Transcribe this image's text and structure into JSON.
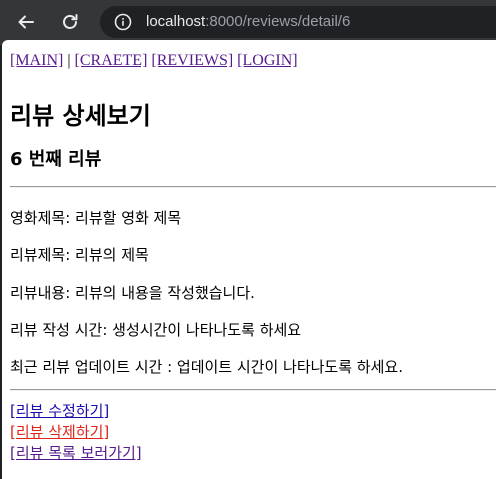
{
  "browser": {
    "url_host": "localhost",
    "url_rest": ":8000/reviews/detail/6"
  },
  "nav": {
    "main": "[MAIN]",
    "separator": "|",
    "create": "[CRAETE]",
    "reviews": "[REVIEWS]",
    "login": "[LOGIN]"
  },
  "page": {
    "title": "리뷰 상세보기",
    "subtitle": "6 번째 리뷰"
  },
  "details": {
    "movie_title": "영화제목: 리뷰할 영화 제목",
    "review_title": "리뷰제목: 리뷰의 제목",
    "review_content": "리뷰내용: 리뷰의 내용을 작성했습니다.",
    "created_time": "리뷰 작성 시간: 생성시간이 나타나도록 하세요",
    "updated_time": "최근 리뷰 업데이트 시간 : 업데이트 시간이 나타나도록 하세요."
  },
  "actions": {
    "edit": "[리뷰 수정하기]",
    "delete": "[리뷰 삭제하기]",
    "list": "[리뷰 목록 보러가기]"
  },
  "colors": {
    "link": "#1a0dab",
    "visited": "#551a8b",
    "delete": "#e0261b"
  }
}
